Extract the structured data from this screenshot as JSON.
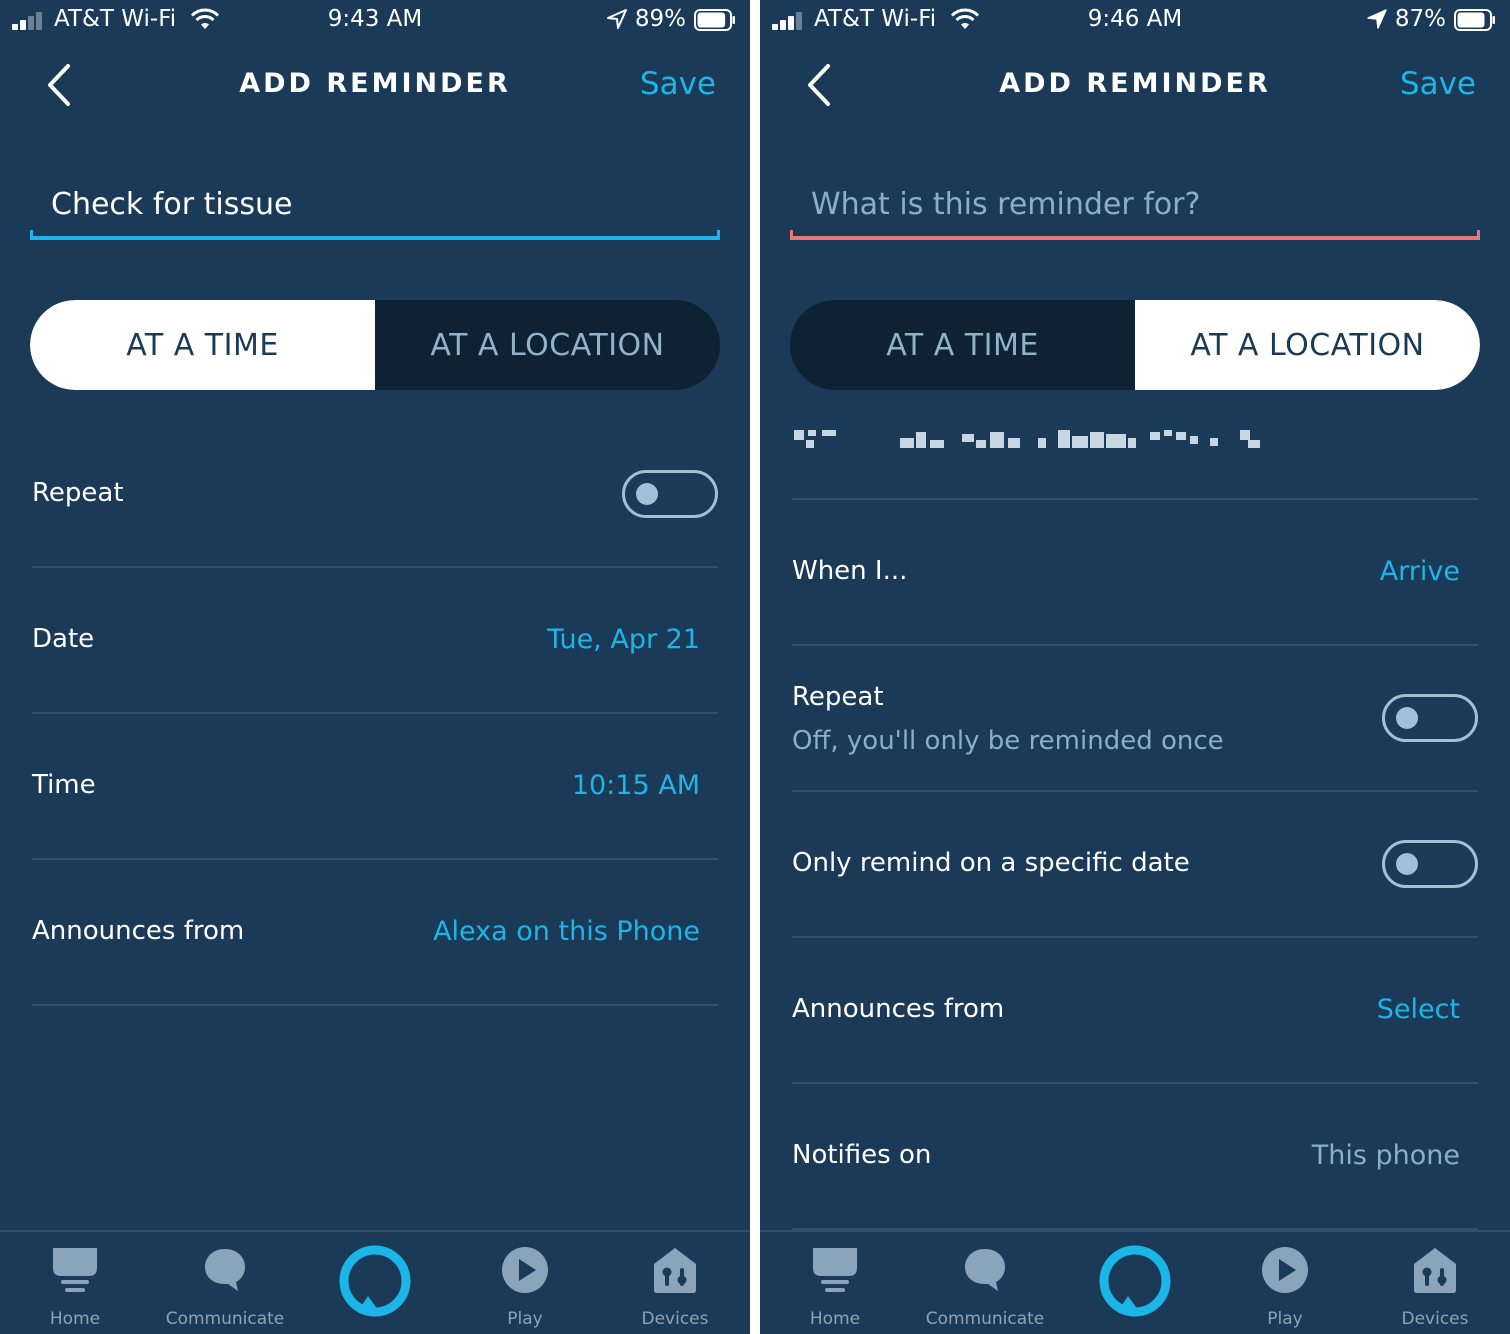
{
  "colors": {
    "background": "#1b3a57",
    "accent": "#1bb5e8",
    "error_underline": "#e97777",
    "muted_text": "#8aafc7",
    "segment_inactive_bg": "#0e2233",
    "divider": "#2e5070"
  },
  "left": {
    "status": {
      "carrier": "AT&T Wi-Fi",
      "time": "9:43 AM",
      "battery": "89%",
      "battery_level": 0.89
    },
    "header": {
      "title": "ADD REMINDER",
      "save": "Save",
      "back_icon": "chevron-left-icon"
    },
    "reminder_input": {
      "value": "Check for tissue",
      "placeholder": "What is this reminder for?"
    },
    "segments": [
      {
        "label": "AT A TIME",
        "active": true
      },
      {
        "label": "AT A LOCATION",
        "active": false
      }
    ],
    "rows": {
      "repeat": {
        "label": "Repeat",
        "toggle": false
      },
      "date": {
        "label": "Date",
        "value": "Tue, Apr 21"
      },
      "time": {
        "label": "Time",
        "value": "10:15 AM"
      },
      "announces": {
        "label": "Announces from",
        "value": "Alexa on this Phone"
      }
    }
  },
  "right": {
    "status": {
      "carrier": "AT&T Wi-Fi",
      "time": "9:46 AM",
      "battery": "87%",
      "battery_level": 0.87
    },
    "header": {
      "title": "ADD REMINDER",
      "save": "Save",
      "back_icon": "chevron-left-icon"
    },
    "reminder_input": {
      "value": "",
      "placeholder": "What is this reminder for?"
    },
    "segments": [
      {
        "label": "AT A TIME",
        "active": false
      },
      {
        "label": "AT A LOCATION",
        "active": true
      }
    ],
    "rows": {
      "when": {
        "label": "When I...",
        "value": "Arrive"
      },
      "repeat": {
        "label": "Repeat",
        "sublabel": "Off, you'll only be reminded once",
        "toggle": false
      },
      "specific_date": {
        "label": "Only remind on a specific date",
        "toggle": false
      },
      "announces": {
        "label": "Announces from",
        "value": "Select"
      },
      "notifies": {
        "label": "Notifies on",
        "value": "This phone"
      }
    }
  },
  "nav": {
    "home": {
      "label": "Home",
      "icon": "home-icon"
    },
    "communicate": {
      "label": "Communicate",
      "icon": "speech-bubble-icon"
    },
    "alexa": {
      "icon": "alexa-ring-icon"
    },
    "play": {
      "label": "Play",
      "icon": "play-icon"
    },
    "devices": {
      "label": "Devices",
      "icon": "devices-house-icon"
    }
  }
}
